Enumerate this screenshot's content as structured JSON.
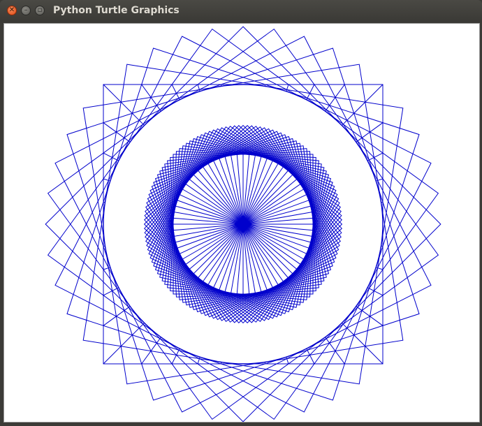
{
  "window": {
    "title": "Python Turtle Graphics",
    "controls": {
      "close_icon": "close-icon",
      "minimize_icon": "minimize-icon",
      "maximize_icon": "maximize-icon"
    }
  },
  "drawing": {
    "pen_color": "#0000cc",
    "background": "#ffffff",
    "shapes": [
      {
        "kind": "rotated-squares",
        "count": 10,
        "step_degrees": 9
      },
      {
        "kind": "rotated-squares",
        "count": 36,
        "step_degrees": 2.5
      },
      {
        "kind": "spokes",
        "count": 72
      }
    ]
  }
}
